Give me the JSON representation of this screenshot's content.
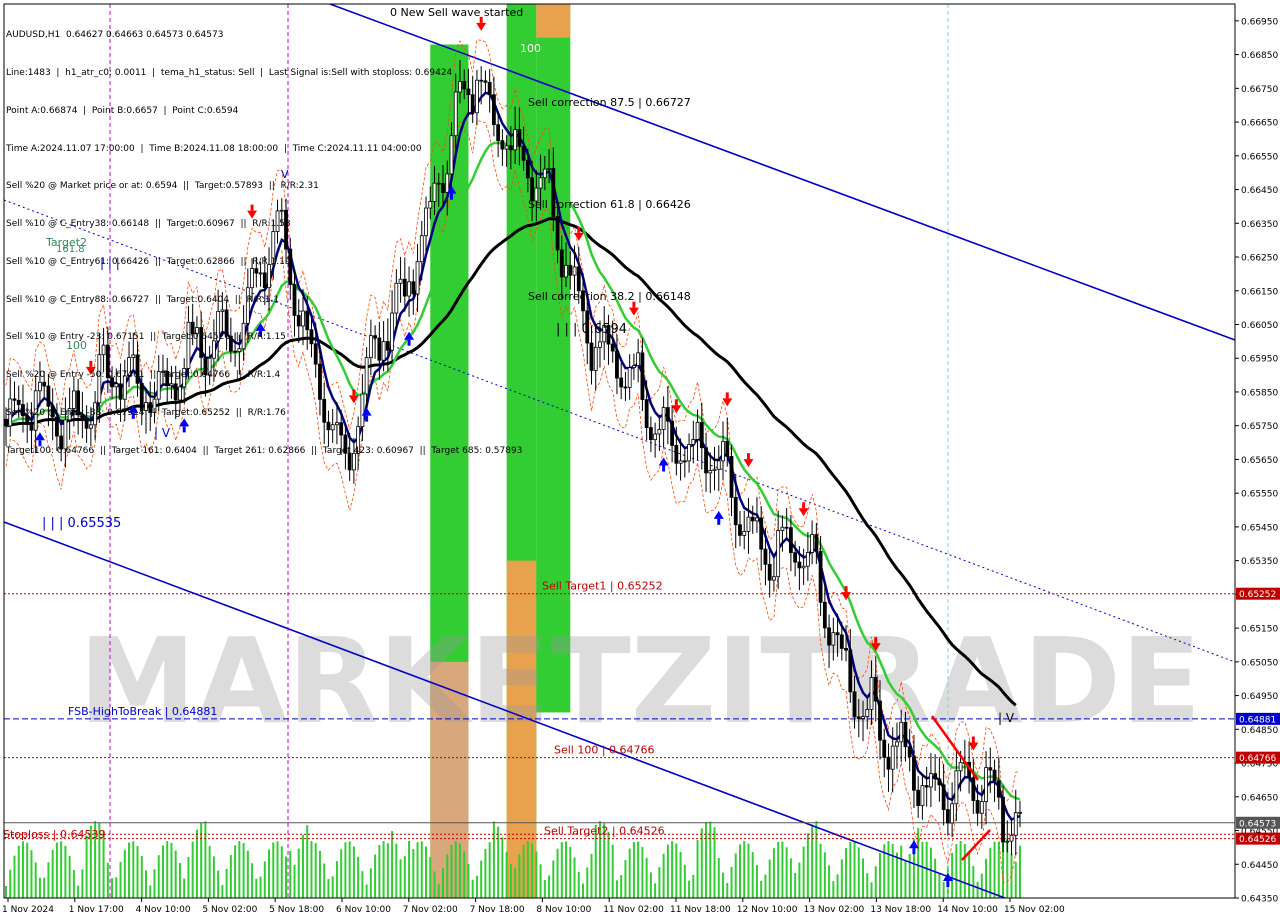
{
  "header": {
    "lines": [
      "AUDUSD,H1  0.64627 0.64663 0.64573 0.64573",
      "Line:1483  |  h1_atr_c0: 0.0011  |  tema_h1_status: Sell  |  Last Signal is:Sell with stoploss: 0.69424",
      "Point A:0.66874  |  Point B:0.6657  |  Point C:0.6594",
      "Time A:2024.11.07 17:00:00  |  Time B:2024.11.08 18:00:00  |  Time C:2024.11.11 04:00:00",
      "Sell %20 @ Market price or at: 0.6594  ||  Target:0.57893  ||  R/R:2.31",
      "Sell %10 @ C_Entry38: 0.66148  ||  Target:0.60967  ||  R/R:1.58",
      "Sell %10 @ C_Entry61: 0.66426  ||  Target:0.62866  ||  R/R:1.19",
      "Sell %10 @ C_Entry88: 0.66727  ||  Target:0.6404  ||  R/R:1.1",
      "Sell %10 @ Entry -23: 0.67151  ||  Target:0.64526  ||  R/R:1.15",
      "Sell %20 @ Entry -50: 0.67461  ||  Target:0.64766  ||  R/R:1.4",
      "Sell %20 @ Entry -88: 0.67914  ||  Target:0.65252  ||  R/R:1.76",
      "Target100: 0.64766  ||  Target 161: 0.6404  ||  Target 261: 0.62866  ||  Target 423: 0.60967  ||  Target 685: 0.57893"
    ]
  },
  "watermark": "MARKETZITRADE",
  "colors": {
    "background": "#ffffff",
    "bull_candle": "#ffffff",
    "bear_candle": "#000000",
    "candle_outline": "#000000",
    "channel": "#0000cd",
    "ma_black": "#000000",
    "ma_green": "#32cd32",
    "ma_navy": "#000080",
    "envelope": "#ff4500",
    "sell_arrow": "#ff0000",
    "buy_arrow": "#0000ff",
    "volume": "#32cd32",
    "zone_green": "#32cd32",
    "zone_orange": "#e8a24e",
    "zone_salmon": "#f7a08a",
    "level_red": "#c00000",
    "level_blue": "#0000cd"
  },
  "chart_data": {
    "type": "candlestick",
    "symbol": "AUDUSD",
    "timeframe": "H1",
    "ylim": [
      0.6435,
      0.67
    ],
    "y_ticks": [
      "0.66950",
      "0.66850",
      "0.66750",
      "0.66650",
      "0.66550",
      "0.66450",
      "0.66350",
      "0.66250",
      "0.66150",
      "0.66050",
      "0.65950",
      "0.65850",
      "0.65750",
      "0.65650",
      "0.65550",
      "0.65450",
      "0.65350",
      "0.65250",
      "0.65150",
      "0.65050",
      "0.64950",
      "0.64850",
      "0.64750",
      "0.64650",
      "0.64550",
      "0.64450",
      "0.64350"
    ],
    "x_ticks": [
      "1 Nov 2024",
      "1 Nov 17:00",
      "4 Nov 10:00",
      "5 Nov 02:00",
      "5 Nov 18:00",
      "6 Nov 10:00",
      "7 Nov 02:00",
      "7 Nov 18:00",
      "8 Nov 10:00",
      "11 Nov 02:00",
      "11 Nov 18:00",
      "12 Nov 10:00",
      "13 Nov 02:00",
      "13 Nov 18:00",
      "14 Nov 10:00",
      "15 Nov 02:00"
    ],
    "last_price": 0.64573,
    "key_points": [
      {
        "label": "1 Nov 2024",
        "price": 0.6575
      },
      {
        "label": "1 Nov 17:00",
        "price": 0.6582
      },
      {
        "label": "4 Nov 10:00",
        "price": 0.6588
      },
      {
        "label": "5 Nov 02:00",
        "price": 0.6595
      },
      {
        "label": "5 Nov 18:00",
        "price": 0.663
      },
      {
        "label": "6 Nov 10:00",
        "price": 0.6565
      },
      {
        "label": "7 Nov 02:00",
        "price": 0.6625
      },
      {
        "label": "7 Nov 18:00",
        "price": 0.668
      },
      {
        "label": "8 Nov 10:00",
        "price": 0.664
      },
      {
        "label": "11 Nov 02:00",
        "price": 0.659
      },
      {
        "label": "11 Nov 18:00",
        "price": 0.6572
      },
      {
        "label": "12 Nov 10:00",
        "price": 0.6545
      },
      {
        "label": "13 Nov 02:00",
        "price": 0.6528
      },
      {
        "label": "13 Nov 18:00",
        "price": 0.6478
      },
      {
        "label": "14 Nov 10:00",
        "price": 0.6468
      },
      {
        "label": "15 Nov 02:00",
        "price": 0.6462
      }
    ],
    "price_levels": [
      {
        "label": "Sell Target1 | 0.65252",
        "price": 0.65252,
        "tag": "0.65252",
        "color": "#c00000",
        "style": "dotted"
      },
      {
        "label": "FSB-HighToBreak | 0.64881",
        "price": 0.64881,
        "tag": "0.64881",
        "color": "#0000cd",
        "style": "dashed"
      },
      {
        "label": "Sell 100 | 0.64766",
        "price": 0.64766,
        "tag": "0.64766",
        "color": "#c00000",
        "style": "dotted"
      },
      {
        "label": "Stoploss | 0.64539",
        "price": 0.64539,
        "tag": "",
        "color": "#c00000",
        "style": "dotted"
      },
      {
        "label": "Sell Target2 | 0.64526",
        "price": 0.64526,
        "tag": "0.64526",
        "color": "#c00000",
        "style": "dotted"
      },
      {
        "label": "",
        "price": 0.64573,
        "tag": "0.64573",
        "color": "#555555",
        "style": "solid"
      }
    ],
    "annotations": [
      "0 New Sell wave started",
      "Sell correction 87.5 | 0.66727",
      "Sell correction 61.8 | 0.66426",
      "Sell correction 38.2 | 0.66148",
      "| | | 0.6594",
      "| | | 0.65535",
      "Target2",
      "161.8",
      "100",
      "| | |",
      "| V",
      "V",
      "| V",
      "100"
    ],
    "title": ""
  }
}
